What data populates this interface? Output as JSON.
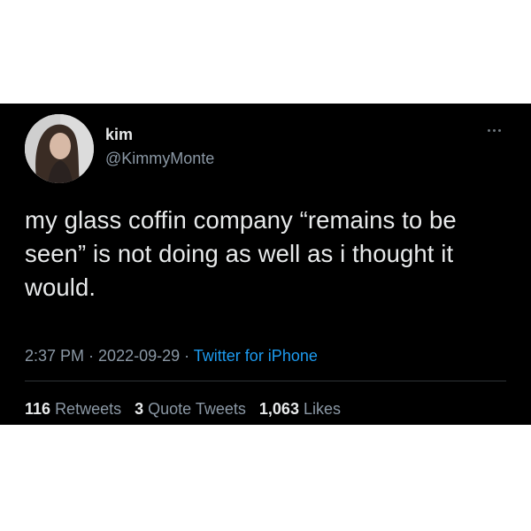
{
  "user": {
    "display_name": "kim",
    "handle": "@KimmyMonte",
    "avatar_icon": "avatar-photo"
  },
  "more_icon": "more-horizontal-icon",
  "tweet": {
    "text_line1": "my glass coffin company “remains to be",
    "text_line2": "seen” is not doing as well as i thought it",
    "text_line3": "would."
  },
  "meta": {
    "time": "2:37 PM",
    "separator": " · ",
    "date": "2022-09-29",
    "source": "Twitter for iPhone"
  },
  "stats": {
    "retweets_count": "116",
    "retweets_label": "Retweets",
    "quotes_count": "3",
    "quotes_label": "Quote Tweets",
    "likes_count": "1,063",
    "likes_label": "Likes"
  },
  "colors": {
    "background": "#000000",
    "text": "#e7e9ea",
    "secondary": "#8b98a5",
    "link": "#1d9bf0"
  }
}
